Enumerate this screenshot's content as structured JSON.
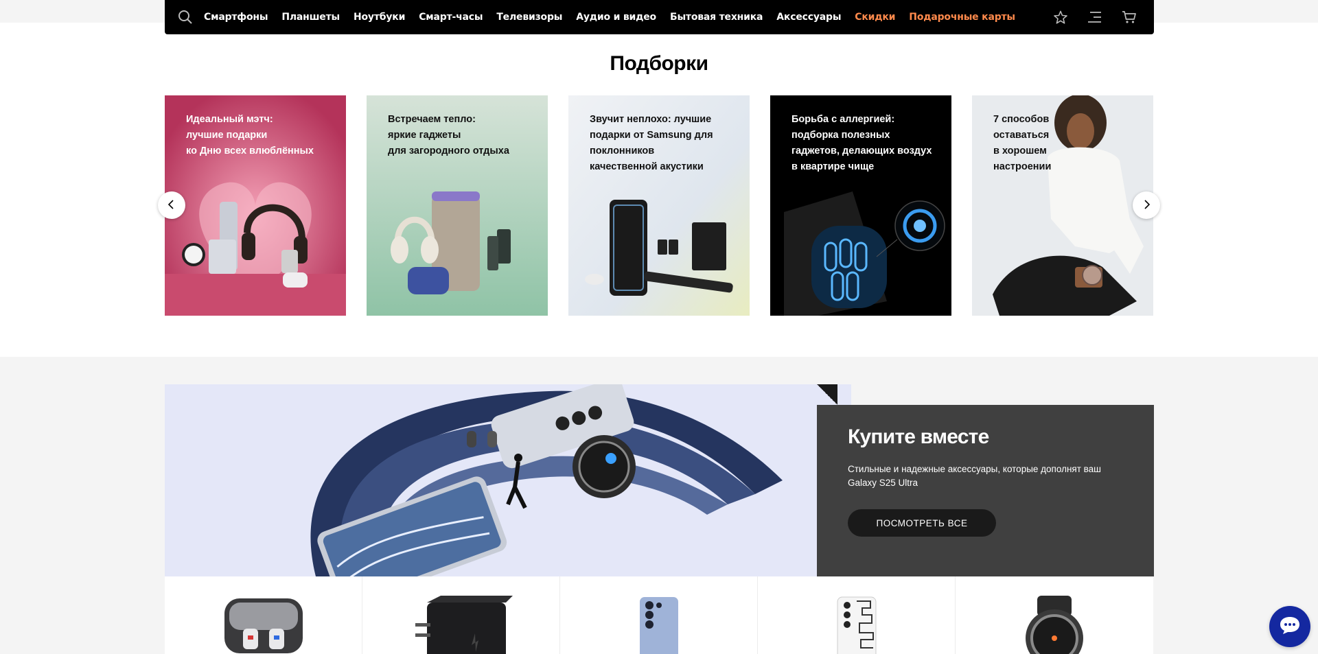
{
  "nav": {
    "items": [
      {
        "label": "Смартфоны",
        "accent": false
      },
      {
        "label": "Планшеты",
        "accent": false
      },
      {
        "label": "Ноутбуки",
        "accent": false
      },
      {
        "label": "Смарт-часы",
        "accent": false
      },
      {
        "label": "Телевизоры",
        "accent": false
      },
      {
        "label": "Аудио и видео",
        "accent": false
      },
      {
        "label": "Бытовая техника",
        "accent": false
      },
      {
        "label": "Аксессуары",
        "accent": false
      },
      {
        "label": "Скидки",
        "accent": true
      },
      {
        "label": "Подарочные карты",
        "accent": true
      }
    ],
    "icons": [
      "search-icon",
      "star-icon",
      "menu-icon",
      "cart-icon"
    ],
    "accent_color": "#ff8a4c"
  },
  "collections": {
    "title": "Подборки",
    "cards": [
      {
        "text": "Идеальный мэтч:\nлучшие подарки\nко Дню всех влюблённых",
        "text_color": "#ffffff",
        "bg": "#b5365a"
      },
      {
        "text": "Встречаем тепло:\nяркие гаджеты\nдля загородного отдыха",
        "text_color": "#111111",
        "bg": "#a9cdb8"
      },
      {
        "text": "Звучит неплохо: лучшие\nподарки от Samsung для\nпоклонников\nкачественной акустики",
        "text_color": "#111111",
        "bg": "#e8edf3"
      },
      {
        "text": "Борьба с аллергией:\nподборка полезных\nгаджетов, делающих воздух\nв квартире чище",
        "text_color": "#ffffff",
        "bg": "#000000"
      },
      {
        "text": "7 способов\nоставаться\nв хорошем\nнастроении",
        "text_color": "#111111",
        "bg": "#e9ecef"
      }
    ],
    "prev_icon": "chevron-left-icon",
    "next_icon": "chevron-right-icon"
  },
  "promo": {
    "title": "Купите вместе",
    "description": "Стильные и надежные аксессуары, которые дополнят ваш Galaxy S25 Ultra",
    "button_label": "ПОСМОТРЕТЬ ВСЕ"
  },
  "products": [
    "earbuds-image",
    "charger-image",
    "phone-case-image",
    "phone-case-pattern-image",
    "watch-image"
  ],
  "chat": {
    "icon": "chat-icon",
    "color": "#1428a0"
  }
}
